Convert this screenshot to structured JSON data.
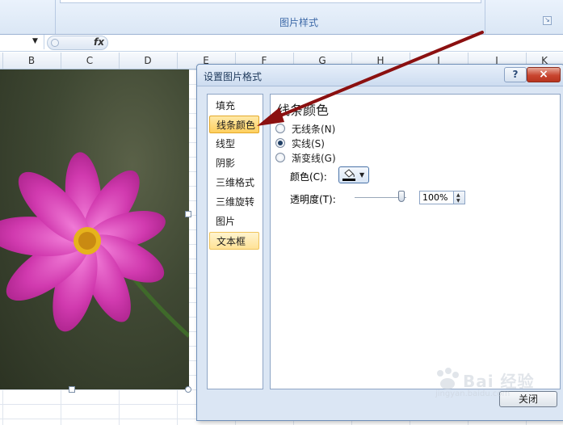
{
  "ribbon": {
    "group_label": "图片样式"
  },
  "formula_bar": {
    "fx_label": "fx"
  },
  "sheet": {
    "columns": [
      "B",
      "C",
      "D",
      "E",
      "F",
      "G",
      "H",
      "I",
      "J",
      "K"
    ]
  },
  "dialog": {
    "title": "设置图片格式",
    "help_label": "?",
    "close_label": "×",
    "nav": [
      {
        "label": "填充",
        "state": "normal"
      },
      {
        "label": "线条颜色",
        "state": "selected"
      },
      {
        "label": "线型",
        "state": "normal"
      },
      {
        "label": "阴影",
        "state": "normal"
      },
      {
        "label": "三维格式",
        "state": "normal"
      },
      {
        "label": "三维旋转",
        "state": "normal"
      },
      {
        "label": "图片",
        "state": "normal"
      },
      {
        "label": "文本框",
        "state": "hover"
      }
    ],
    "panel": {
      "title": "线条颜色",
      "options": [
        {
          "label": "无线条(N)",
          "checked": false
        },
        {
          "label": "实线(S)",
          "checked": true
        },
        {
          "label": "渐变线(G)",
          "checked": false
        }
      ],
      "color_label": "颜色(C):",
      "color_value": "#000000",
      "transparency_label": "透明度(T):",
      "transparency_value": "100%",
      "transparency_fraction": 1.0
    },
    "close_button_label": "关闭"
  },
  "watermark": {
    "text": "Bai 经验",
    "sub": "jingyan.baidu.com"
  },
  "colors": {
    "arrow": "#8b1010",
    "flower": "#d63bb0",
    "selected_nav": "#ffcf5e"
  },
  "icons": {
    "bucket": "paint-bucket-icon",
    "dropdown": "chevron-down-icon"
  }
}
